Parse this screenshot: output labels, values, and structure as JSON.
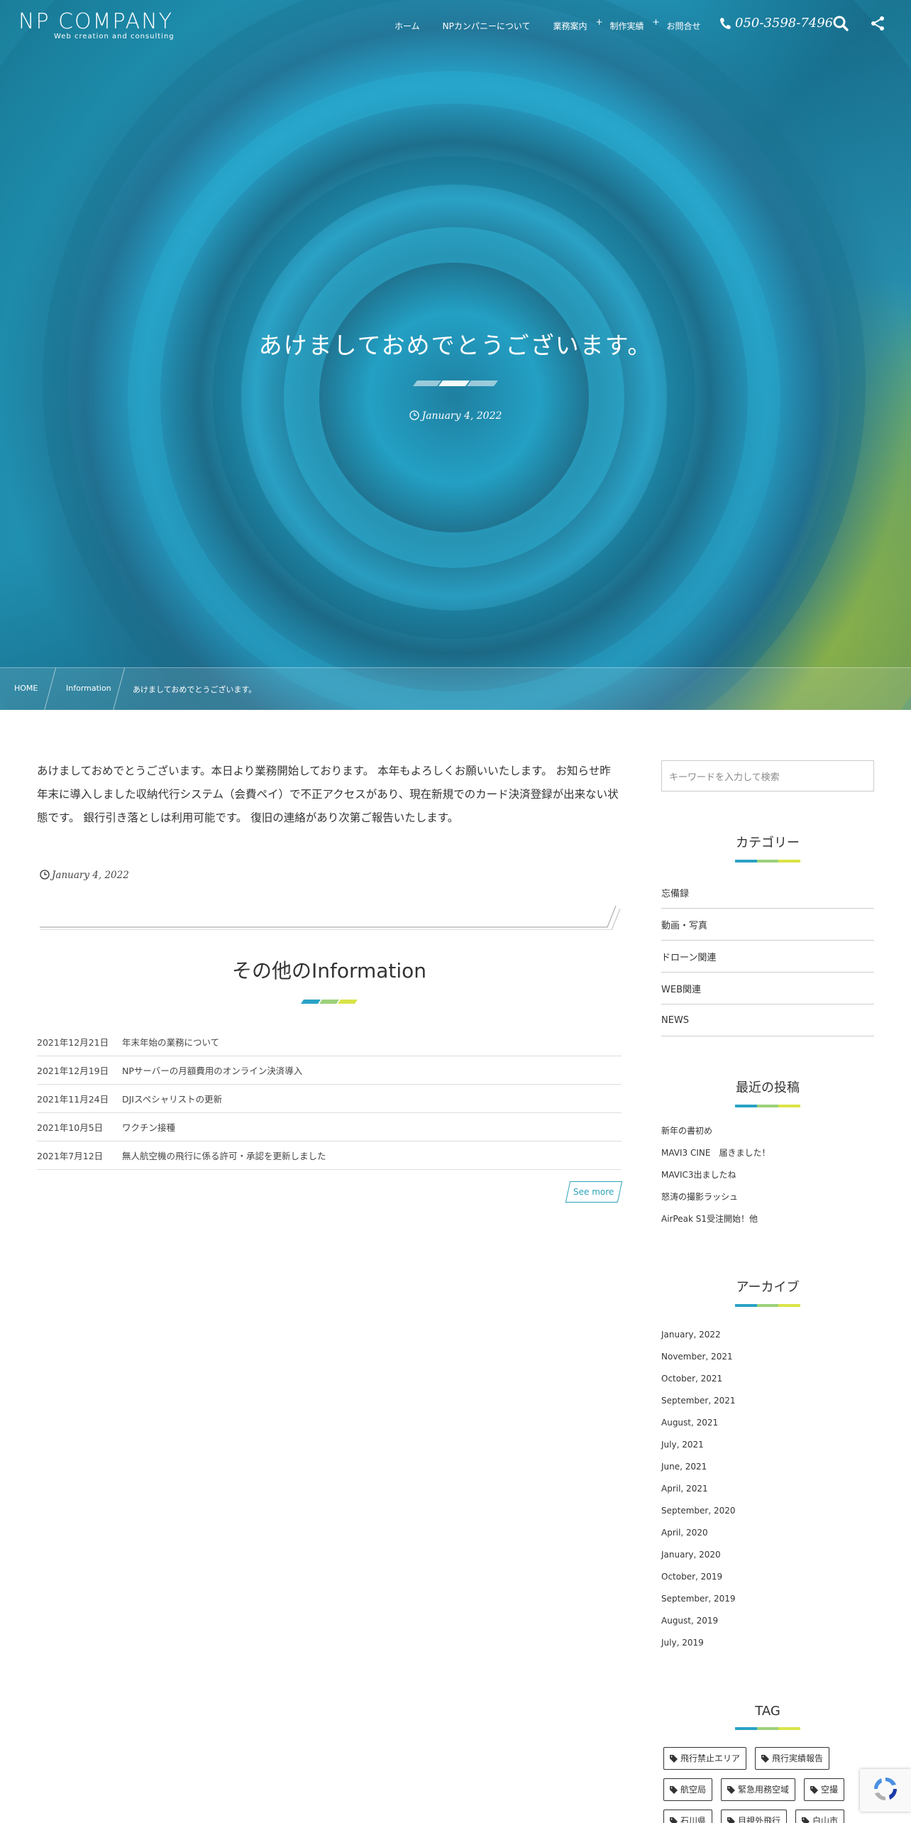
{
  "header": {
    "logo_main": "NP COMPANY",
    "logo_sub": "Web creation and consulting",
    "nav": [
      {
        "label": "ホーム",
        "plus": ""
      },
      {
        "label": "NPカンパニーについて",
        "plus": ""
      },
      {
        "label": "業務案内",
        "plus": "+"
      },
      {
        "label": "制作実績",
        "plus": "+"
      },
      {
        "label": "お問合せ",
        "plus": ""
      }
    ],
    "phone": "050-3598-7496",
    "icons": [
      "phone-icon",
      "search-icon",
      "share-icon"
    ]
  },
  "hero": {
    "title": "あけましておめでとうございます。",
    "date": "January 4, 2022"
  },
  "breadcrumb": [
    "HOME",
    "Information",
    "あけましておめでとうございます。"
  ],
  "post": {
    "body": "あけましておめでとうございます。本日より業務開始しております。 本年もよろしくお願いいたします。 お知らせ昨年末に導入しました収納代行システム（会費ペイ）で不正アクセスがあり、現在新規でのカード決済登録が出来ない状態です。 銀行引き落としは利用可能です。 復旧の連絡があり次第ご報告いたします。",
    "date": "January 4, 2022"
  },
  "other": {
    "title": "その他のInformation",
    "items": [
      {
        "date": "2021年12月21日",
        "title": "年末年始の業務について"
      },
      {
        "date": "2021年12月19日",
        "title": "NPサーバーの月額費用のオンライン決済導入"
      },
      {
        "date": "2021年11月24日",
        "title": "DJIスペシャリストの更新"
      },
      {
        "date": "2021年10月5日",
        "title": "ワクチン接種"
      },
      {
        "date": "2021年7月12日",
        "title": "無人航空機の飛行に係る許可・承認を更新しました"
      }
    ],
    "see_more": "See more"
  },
  "sidebar": {
    "search_placeholder": "キーワードを入力して検索",
    "categories_title": "カテゴリー",
    "categories": [
      "忘備録",
      "動画・写真",
      "ドローン関連",
      "WEB関連",
      "NEWS"
    ],
    "recent_title": "最近の投稿",
    "recent": [
      "新年の書初め",
      "MAVI3 CINE　届きました！",
      "MAVIC3出ましたね",
      "怒涛の撮影ラッシュ",
      "AirPeak S1受注開始！他"
    ],
    "archive_title": "アーカイブ",
    "archives": [
      "January, 2022",
      "November, 2021",
      "October, 2021",
      "September, 2021",
      "August, 2021",
      "July, 2021",
      "June, 2021",
      "April, 2021",
      "September, 2020",
      "April, 2020",
      "January, 2020",
      "October, 2019",
      "September, 2019",
      "August, 2019",
      "July, 2019"
    ],
    "tag_title": "TAG",
    "tags": [
      "飛行禁止エリア",
      "飛行実績報告",
      "航空局",
      "緊急用務空域",
      "空撮",
      "石川県",
      "目視外飛行",
      "白山市"
    ]
  },
  "colors": {
    "accent_blue": "#2aa2c6",
    "accent_teal": "#5fc2c2",
    "accent_yellow": "#d9e447"
  }
}
